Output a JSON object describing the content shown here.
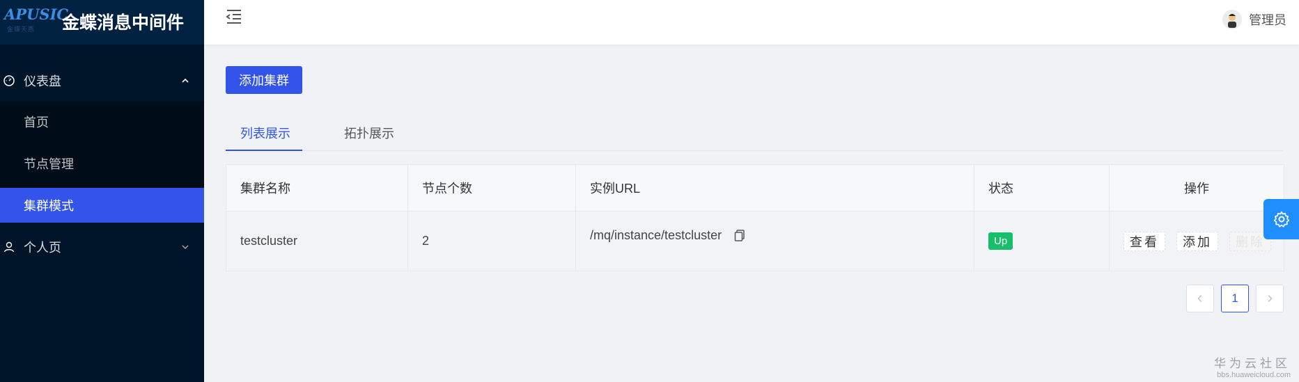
{
  "brand": {
    "logo_text": "APUSIC",
    "logo_sub": "金蝶天燕",
    "title": "金蝶消息中间件"
  },
  "sidebar": {
    "groups": [
      {
        "label": "仪表盘",
        "icon": "dashboard-icon",
        "expanded": true
      },
      {
        "label": "个人页",
        "icon": "user-icon",
        "expanded": false
      }
    ],
    "items": [
      {
        "label": "首页",
        "active": false
      },
      {
        "label": "节点管理",
        "active": false
      },
      {
        "label": "集群模式",
        "active": true
      }
    ]
  },
  "header": {
    "user_name": "管理员"
  },
  "toolbar": {
    "add_cluster_label": "添加集群"
  },
  "tabs": [
    {
      "label": "列表展示",
      "active": true
    },
    {
      "label": "拓扑展示",
      "active": false
    }
  ],
  "table": {
    "headers": [
      "集群名称",
      "节点个数",
      "实例URL",
      "状态",
      "操作"
    ],
    "rows": [
      {
        "name": "testcluster",
        "node_count": "2",
        "url": "/mq/instance/testcluster",
        "status": "Up",
        "actions": [
          "查看",
          "添加",
          "删除"
        ]
      }
    ]
  },
  "pagination": {
    "current": "1",
    "prev": "<",
    "next": ">"
  },
  "watermark": {
    "line1": "华为云社区",
    "line2": "bbs.huaweicloud.com"
  },
  "colors": {
    "primary": "#3354ea",
    "sidebar_bg": "#001529",
    "status_up": "#19be6b",
    "float_button": "#1f8fff"
  }
}
